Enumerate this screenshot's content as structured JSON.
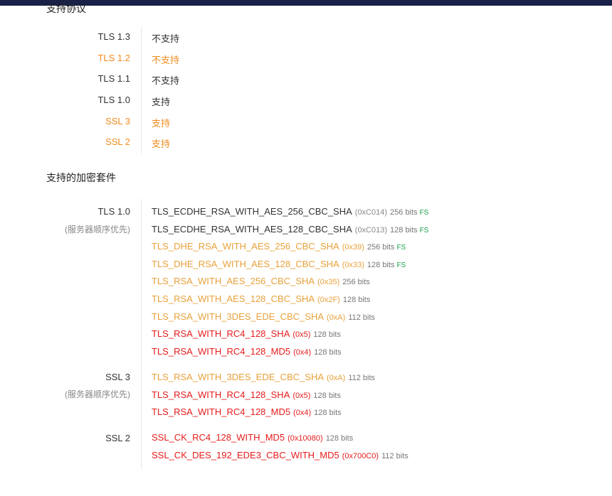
{
  "protocols_title": "支持协议",
  "protocols": [
    {
      "name": "TLS 1.3",
      "status": "不支持"
    },
    {
      "name": "TLS 1.2",
      "status": "不支持"
    },
    {
      "name": "TLS 1.1",
      "status": "不支持"
    },
    {
      "name": "TLS 1.0",
      "status": "支持"
    },
    {
      "name": "SSL 3",
      "status": "支持"
    },
    {
      "name": "SSL 2",
      "status": "支持"
    }
  ],
  "ciphers_title": "支持的加密套件",
  "groups": [
    {
      "protocol": "TLS 1.0",
      "note": "(服务器顺序优先)",
      "suites": [
        {
          "name": "TLS_ECDHE_RSA_WITH_AES_256_CBC_SHA",
          "code": "(0xC014)",
          "bits": "256 bits",
          "fs": "FS"
        },
        {
          "name": "TLS_ECDHE_RSA_WITH_AES_128_CBC_SHA",
          "code": "(0xC013)",
          "bits": "128 bits",
          "fs": "FS"
        },
        {
          "name": "TLS_DHE_RSA_WITH_AES_256_CBC_SHA",
          "code": "(0x39)",
          "bits": "256 bits",
          "fs": "FS"
        },
        {
          "name": "TLS_DHE_RSA_WITH_AES_128_CBC_SHA",
          "code": "(0x33)",
          "bits": "128 bits",
          "fs": "FS"
        },
        {
          "name": "TLS_RSA_WITH_AES_256_CBC_SHA",
          "code": "(0x35)",
          "bits": "256 bits",
          "fs": ""
        },
        {
          "name": "TLS_RSA_WITH_AES_128_CBC_SHA",
          "code": "(0x2F)",
          "bits": "128 bits",
          "fs": ""
        },
        {
          "name": "TLS_RSA_WITH_3DES_EDE_CBC_SHA",
          "code": "(0xA)",
          "bits": "112 bits",
          "fs": ""
        },
        {
          "name": "TLS_RSA_WITH_RC4_128_SHA",
          "code": "(0x5)",
          "bits": "128 bits",
          "fs": ""
        },
        {
          "name": "TLS_RSA_WITH_RC4_128_MD5",
          "code": "(0x4)",
          "bits": "128 bits",
          "fs": ""
        }
      ]
    },
    {
      "protocol": "SSL 3",
      "note": "(服务器顺序优先)",
      "suites": [
        {
          "name": "TLS_RSA_WITH_3DES_EDE_CBC_SHA",
          "code": "(0xA)",
          "bits": "112 bits",
          "fs": ""
        },
        {
          "name": "TLS_RSA_WITH_RC4_128_SHA",
          "code": "(0x5)",
          "bits": "128 bits",
          "fs": ""
        },
        {
          "name": "TLS_RSA_WITH_RC4_128_MD5",
          "code": "(0x4)",
          "bits": "128 bits",
          "fs": ""
        }
      ]
    },
    {
      "protocol": "SSL 2",
      "note": "",
      "suites": [
        {
          "name": "SSL_CK_RC4_128_WITH_MD5",
          "code": "(0x10080)",
          "bits": "128 bits",
          "fs": ""
        },
        {
          "name": "SSL_CK_DES_192_EDE3_CBC_WITH_MD5",
          "code": "(0x700C0)",
          "bits": "112 bits",
          "fs": ""
        }
      ]
    }
  ],
  "colors": {
    "normal": "#333333",
    "warning_orange": "#f08c1e",
    "weak_yellow": "#e8a13a",
    "insecure_red": "#e51c1c",
    "fs_green": "#1aa14b",
    "topbar": "#1a2147"
  }
}
